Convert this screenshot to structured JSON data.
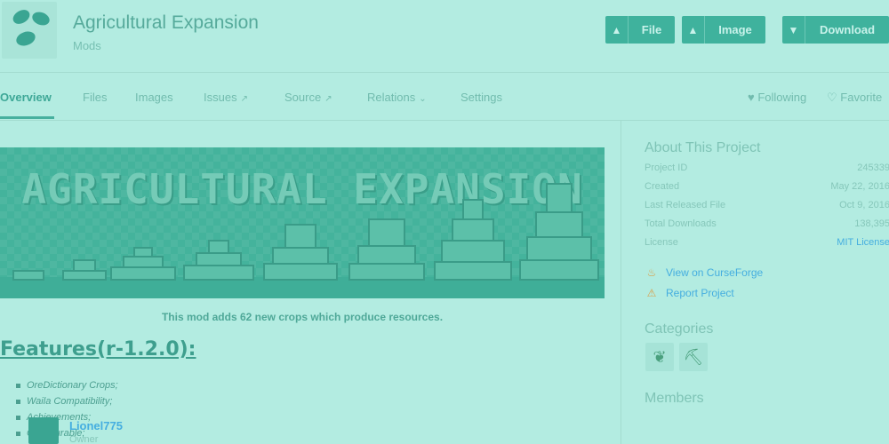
{
  "project": {
    "title": "Agricultural Expansion",
    "subtitle": "Mods"
  },
  "header_buttons": {
    "file": "File",
    "image": "Image",
    "download": "Download"
  },
  "nav": {
    "overview": "Overview",
    "files": "Files",
    "images": "Images",
    "issues": "Issues",
    "source": "Source",
    "relations": "Relations",
    "settings": "Settings",
    "following": "Following",
    "favorite": "Favorite"
  },
  "banner": {
    "title": "AGRICULTURAL EXPANSION"
  },
  "body": {
    "intro": "This mod adds 62 new crops which produce resources.",
    "features_heading": "Features(r-1.2.0):",
    "features": [
      "OreDictionary Crops;",
      "Waila Compatibility;",
      "Achievements;",
      "Configurable;"
    ]
  },
  "about": {
    "heading": "About This Project",
    "rows": [
      {
        "label": "Project ID",
        "value": "245339"
      },
      {
        "label": "Created",
        "value": "May 22, 2016"
      },
      {
        "label": "Last Released File",
        "value": "Oct 9, 2016"
      },
      {
        "label": "Total Downloads",
        "value": "138,395"
      },
      {
        "label": "License",
        "value": "MIT License"
      }
    ],
    "view_link": "View on CurseForge",
    "report_link": "Report Project"
  },
  "categories": {
    "heading": "Categories",
    "icons": [
      "leaf-category-icon",
      "pickaxe-category-icon"
    ]
  },
  "members": {
    "heading": "Members",
    "list": [
      {
        "name": "Lionel775",
        "role": "Owner"
      }
    ]
  },
  "colors": {
    "background": "#b3ece1",
    "accent_button": "#3fb29d",
    "link": "#45aee0"
  }
}
